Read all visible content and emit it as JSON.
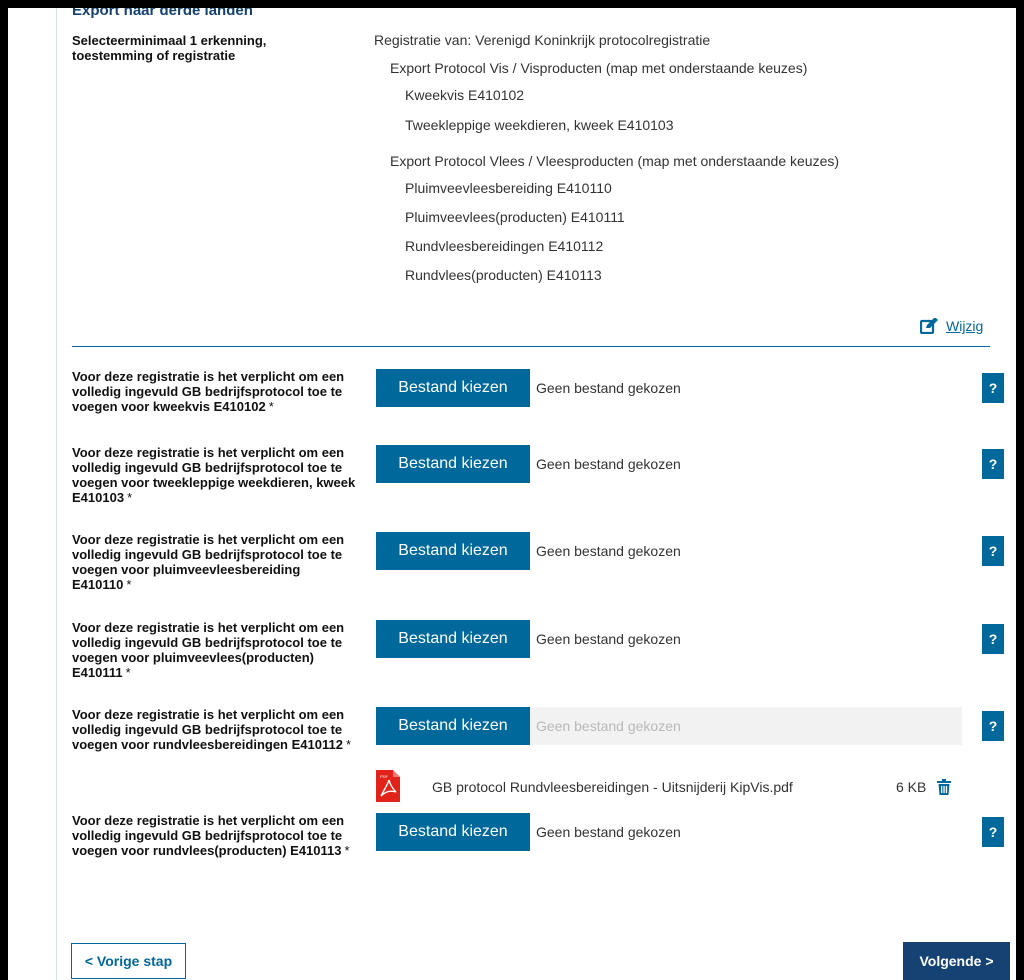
{
  "section_title": "Export naar derde landen",
  "selection_label": "Selecteerminimaal 1 erkenning, toestemming of registratie",
  "tree": {
    "root": "Registratie van: Verenigd Koninkrijk protocolregistratie",
    "groups": [
      {
        "title": "Export Protocol Vis / Visproducten (map met onderstaande keuzes)",
        "items": [
          "Kweekvis E410102",
          "Tweekleppige weekdieren, kweek E410103"
        ]
      },
      {
        "title": "Export Protocol Vlees / Vleesproducten (map met onderstaande keuzes)",
        "items": [
          "Pluimveevleesbereiding E410110",
          "Pluimveevlees(producten) E410111",
          "Rundvleesbereidingen E410112",
          "Rundvlees(producten) E410113"
        ]
      }
    ]
  },
  "edit_label": "Wijzig",
  "required_marker": "*",
  "help_label": "?",
  "uploads": [
    {
      "label": "Voor deze registratie is het verplicht om een volledig ingevuld GB bedrijfsprotocol toe te voegen voor kweekvis E410102",
      "button": "Bestand kiezen",
      "status": "Geen bestand gekozen"
    },
    {
      "label": "Voor deze registratie is het verplicht om een volledig ingevuld GB bedrijfsprotocol toe te voegen voor tweekleppige weekdieren, kweek E410103",
      "button": "Bestand kiezen",
      "status": "Geen bestand gekozen"
    },
    {
      "label": "Voor deze registratie is het verplicht om een volledig ingevuld GB bedrijfsprotocol toe te voegen voor pluimveevleesbereiding E410110",
      "button": "Bestand kiezen",
      "status": "Geen bestand gekozen"
    },
    {
      "label": "Voor deze registratie is het verplicht om een volledig ingevuld GB bedrijfsprotocol toe te voegen voor pluimveevlees(producten) E410111",
      "button": "Bestand kiezen",
      "status": "Geen bestand gekozen"
    },
    {
      "label": "Voor deze registratie is het verplicht om een volledig ingevuld GB bedrijfsprotocol toe te voegen voor rundvleesbereidingen E410112",
      "button": "Bestand kiezen",
      "status": "Geen bestand gekozen"
    },
    {
      "label": "Voor deze registratie is het verplicht om een volledig ingevuld GB bedrijfsprotocol toe te voegen voor rundvlees(producten) E410113",
      "button": "Bestand kiezen",
      "status": "Geen bestand gekozen"
    }
  ],
  "uploaded_file": {
    "name": "GB protocol Rundvleesbereidingen - Uitsnijderij KipVis.pdf",
    "size": "6 KB",
    "icon": "pdf-file-icon",
    "icon_text": "PDF"
  },
  "nav": {
    "prev": "< Vorige stap",
    "next": "Volgende >"
  },
  "colors": {
    "primary": "#01689b",
    "dark_blue": "#154273",
    "pdf_red": "#e2231a"
  }
}
